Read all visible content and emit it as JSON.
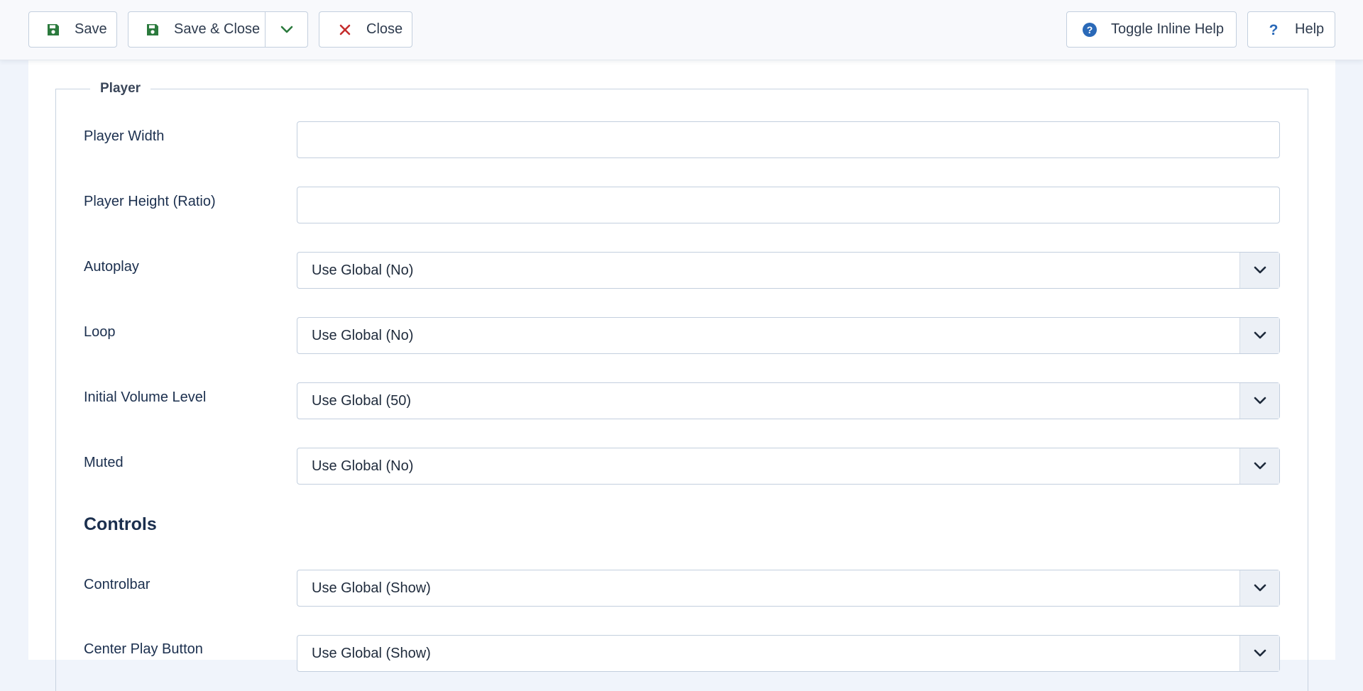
{
  "toolbar": {
    "save_label": "Save",
    "save_close_label": "Save & Close",
    "close_label": "Close",
    "toggle_inline_help_label": "Toggle Inline Help",
    "help_label": "Help"
  },
  "fieldset": {
    "legend": "Player"
  },
  "fields": {
    "player_width": {
      "label": "Player Width",
      "value": ""
    },
    "player_height": {
      "label": "Player Height (Ratio)",
      "value": ""
    },
    "autoplay": {
      "label": "Autoplay",
      "value": "Use Global (No)"
    },
    "loop": {
      "label": "Loop",
      "value": "Use Global (No)"
    },
    "initial_volume": {
      "label": "Initial Volume Level",
      "value": "Use Global (50)"
    },
    "muted": {
      "label": "Muted",
      "value": "Use Global (No)"
    }
  },
  "controls": {
    "heading": "Controls",
    "controlbar": {
      "label": "Controlbar",
      "value": "Use Global (Show)"
    },
    "center_play_button": {
      "label": "Center Play Button",
      "value": "Use Global (Show)"
    }
  },
  "colors": {
    "save_icon": "#2b7a3d",
    "close_icon": "#c52d2d",
    "help_icon": "#2a69b8",
    "accent_text": "#1b2f4e"
  },
  "icons": {
    "save": "floppy-disk-icon",
    "dropdown": "chevron-down-icon",
    "close": "close-x-icon",
    "inline_help": "question-circle-icon",
    "help": "question-mark-icon"
  }
}
